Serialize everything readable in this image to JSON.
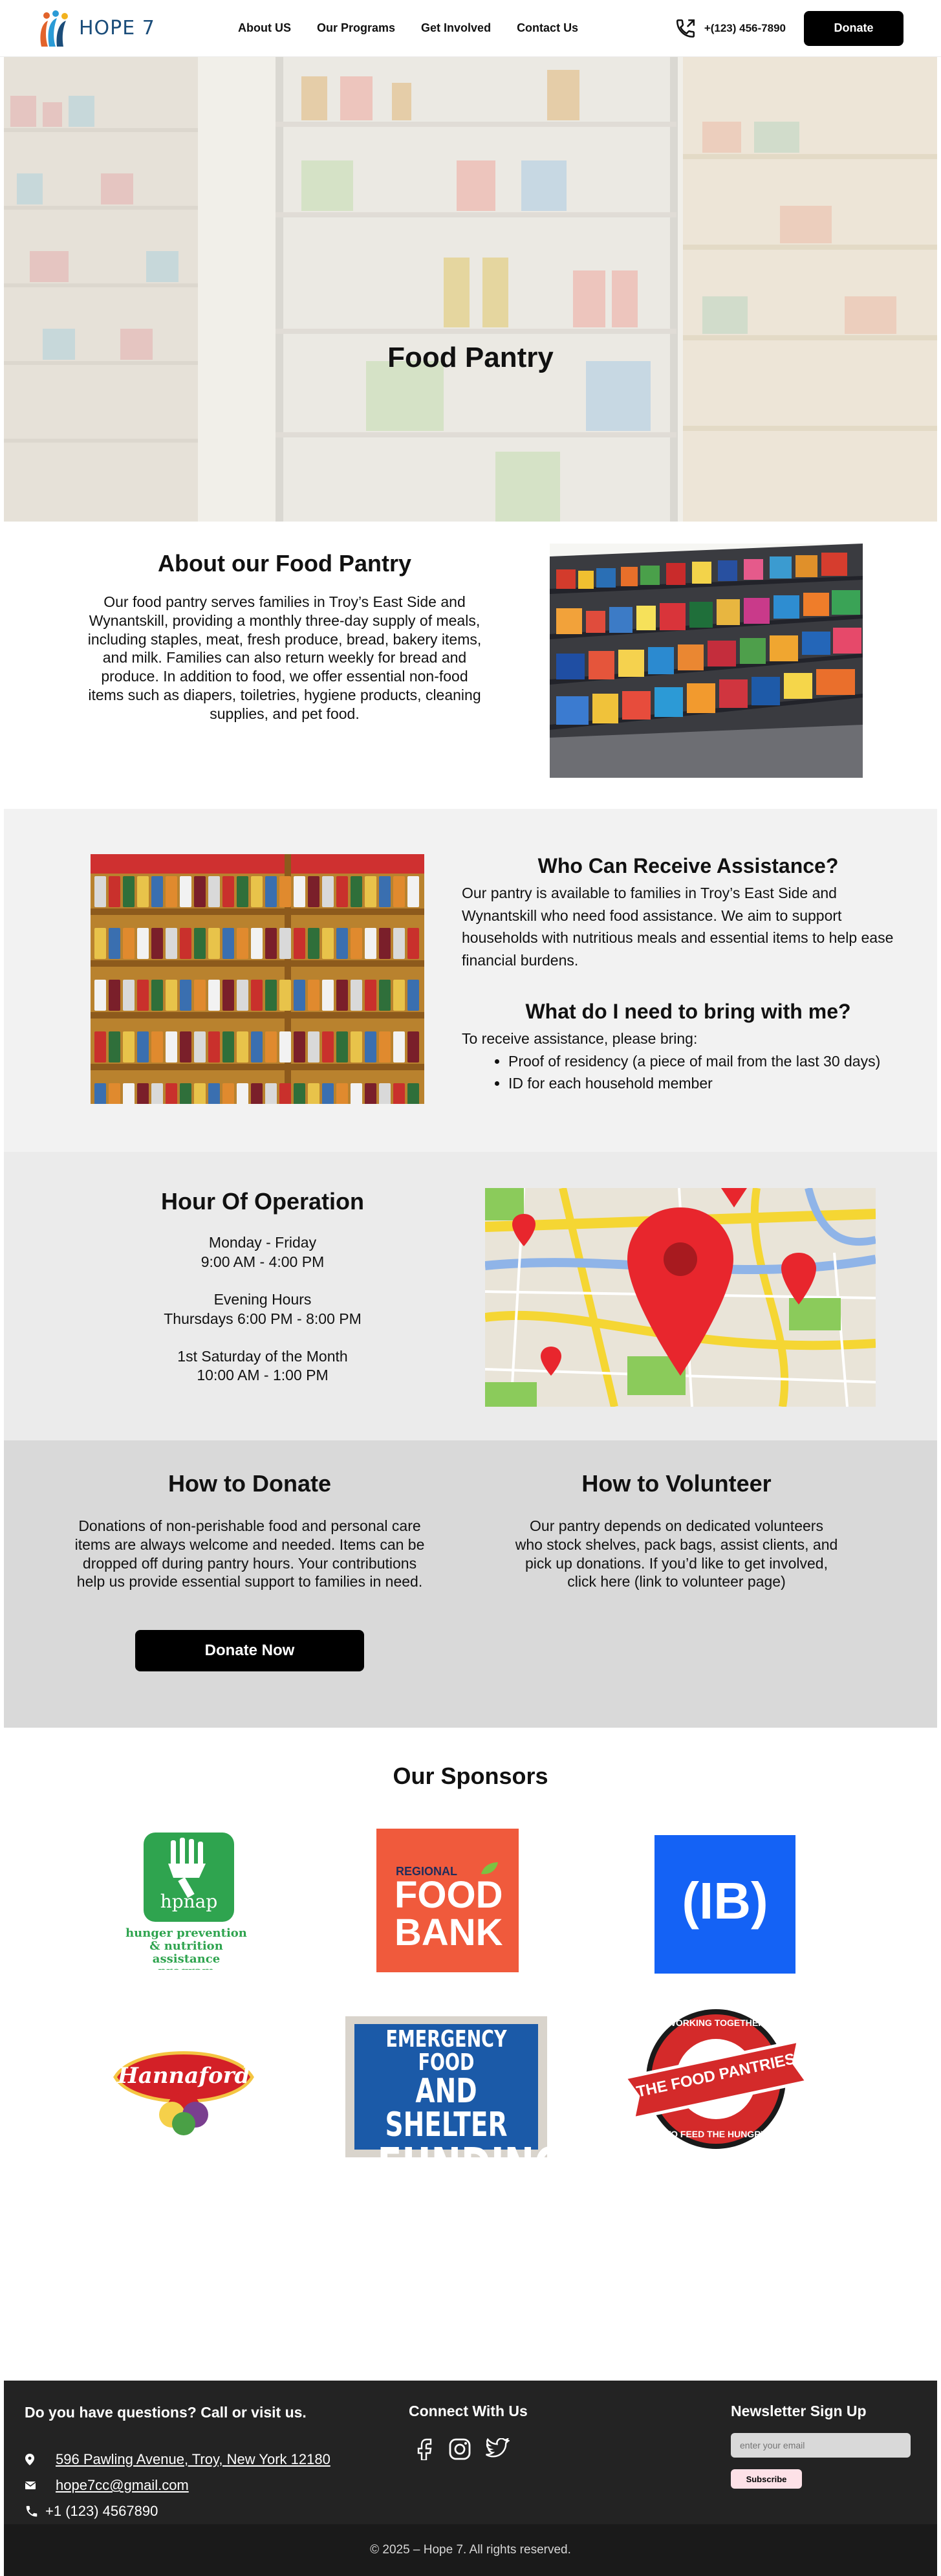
{
  "brand": {
    "name": "HOPE 7"
  },
  "nav": {
    "links": [
      "About US",
      "Our Programs",
      "Get Involved",
      "Contact Us"
    ],
    "phone": "+(123) 456-7890",
    "donate_label": "Donate"
  },
  "hero": {
    "title": "Food Pantry"
  },
  "about": {
    "title": "About our Food Pantry",
    "body": "Our food pantry serves families in Troy’s East Side and Wynantskill, providing a monthly three-day supply of meals, including staples, meat, fresh produce, bread, bakery items, and milk. Families can also return weekly for bread and produce. In addition to food, we offer essential non-food items such as diapers, toiletries, hygiene products, cleaning supplies, and pet food."
  },
  "assistance": {
    "who_title": "Who Can Receive Assistance?",
    "who_body": "Our pantry is available to families in Troy’s East Side and Wynantskill who need food assistance. We aim to support households with nutritious meals and essential items to help ease financial burdens.",
    "bring_title": "What do I need to bring with me?",
    "bring_intro": "To receive assistance, please bring:",
    "bring_items": [
      "Proof of residency (a piece of mail from the last 30 days)",
      "ID for each household member"
    ]
  },
  "hours": {
    "title": "Hour Of Operation",
    "weekday_label": "Monday - Friday",
    "weekday_time": "9:00 AM - 4:00 PM",
    "evening_label": "Evening Hours",
    "evening_time": "Thursdays 6:00 PM - 8:00 PM",
    "saturday_label": "1st Saturday of the Month",
    "saturday_time": "10:00 AM - 1:00 PM"
  },
  "donate": {
    "title": "How to Donate",
    "body": "Donations of non-perishable food and personal care items are always welcome and needed. Items can be dropped off during pantry hours. Your contributions help us provide essential support to families in need.",
    "button": "Donate Now"
  },
  "volunteer": {
    "title": "How to Volunteer",
    "body": "Our pantry depends on dedicated volunteers who stock shelves, pack bags, assist clients, and pick up donations. If you’d like to get involved, click here (link to volunteer page)"
  },
  "sponsors": {
    "title": "Our Sponsors",
    "hpnap": {
      "abbr": "hpnap",
      "line1": "hunger prevention",
      "line2": "& nutrition assistance",
      "line3": "program"
    },
    "foodbank": {
      "line1": "REGIONAL",
      "line2": "FOOD",
      "line3": "BANK"
    },
    "ib": {
      "text": "(IB)"
    },
    "hannaford": {
      "text": "Hannaford"
    },
    "efsf": {
      "line1": "EMERGENCY FOOD",
      "line2": "AND SHELTER",
      "line3": "FUNDING"
    },
    "pantries": {
      "top": "WORKING TOGETHER",
      "banner": "THE FOOD PANTRIES",
      "bottom": "TO FEED THE HUNGRY"
    }
  },
  "footer": {
    "questions_title": "Do you have questions? Call or visit us.",
    "address": "596 Pawling Avenue, Troy, New York 12180",
    "email": "hope7cc@gmail.com",
    "phone": "+1 (123) 4567890",
    "connect_title": "Connect With Us",
    "newsletter_title": "Newsletter Sign Up",
    "newsletter_placeholder": "enter your email",
    "subscribe_label": "Subscribe",
    "copyright": "© 2025 – Hope 7. All rights reserved."
  },
  "colors": {
    "accent": "#000000",
    "footer_bg": "#232323",
    "foodbank": "#f05a3c",
    "ib_blue": "#1462f5",
    "hpnap_green": "#2fa44f",
    "hannaford_red": "#d32027"
  }
}
